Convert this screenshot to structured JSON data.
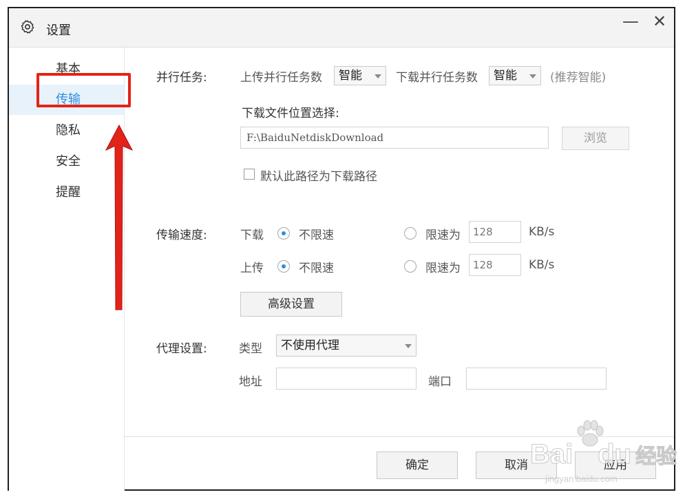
{
  "window": {
    "title": "设置",
    "minimize": "—",
    "close": "✕"
  },
  "sidebar": {
    "items": [
      {
        "label": "基本"
      },
      {
        "label": "传输",
        "active": true
      },
      {
        "label": "隐私"
      },
      {
        "label": "安全"
      },
      {
        "label": "提醒"
      }
    ]
  },
  "parallel": {
    "section_label": "并行任务:",
    "upload_label": "上传并行任务数",
    "upload_value": "智能",
    "download_label": "下载并行任务数",
    "download_value": "智能",
    "hint": "(推荐智能)"
  },
  "download_location": {
    "label": "下载文件位置选择:",
    "path": "F:\\BaiduNetdiskDownload",
    "browse": "浏览",
    "default_checkbox": "默认此路径为下载路径",
    "default_checked": false
  },
  "speed": {
    "section_label": "传输速度:",
    "download": {
      "label": "下载",
      "unlimited": "不限速",
      "limit": "限速为",
      "value": "128",
      "unit": "KB/s",
      "selected": "unlimited"
    },
    "upload": {
      "label": "上传",
      "unlimited": "不限速",
      "limit": "限速为",
      "value": "128",
      "unit": "KB/s",
      "selected": "unlimited"
    },
    "advanced": "高级设置"
  },
  "proxy": {
    "section_label": "代理设置:",
    "type_label": "类型",
    "type_value": "不使用代理",
    "address_label": "地址",
    "address_value": "",
    "port_label": "端口",
    "port_value": ""
  },
  "footer": {
    "ok": "确定",
    "cancel": "取消",
    "apply": "应用"
  },
  "watermark": {
    "brand_left": "Bai",
    "brand_right": "du",
    "cn": "经验",
    "url": "jingyan.baidu.com"
  },
  "colors": {
    "accent": "#2c8ee0",
    "annotation": "#e2231a"
  }
}
